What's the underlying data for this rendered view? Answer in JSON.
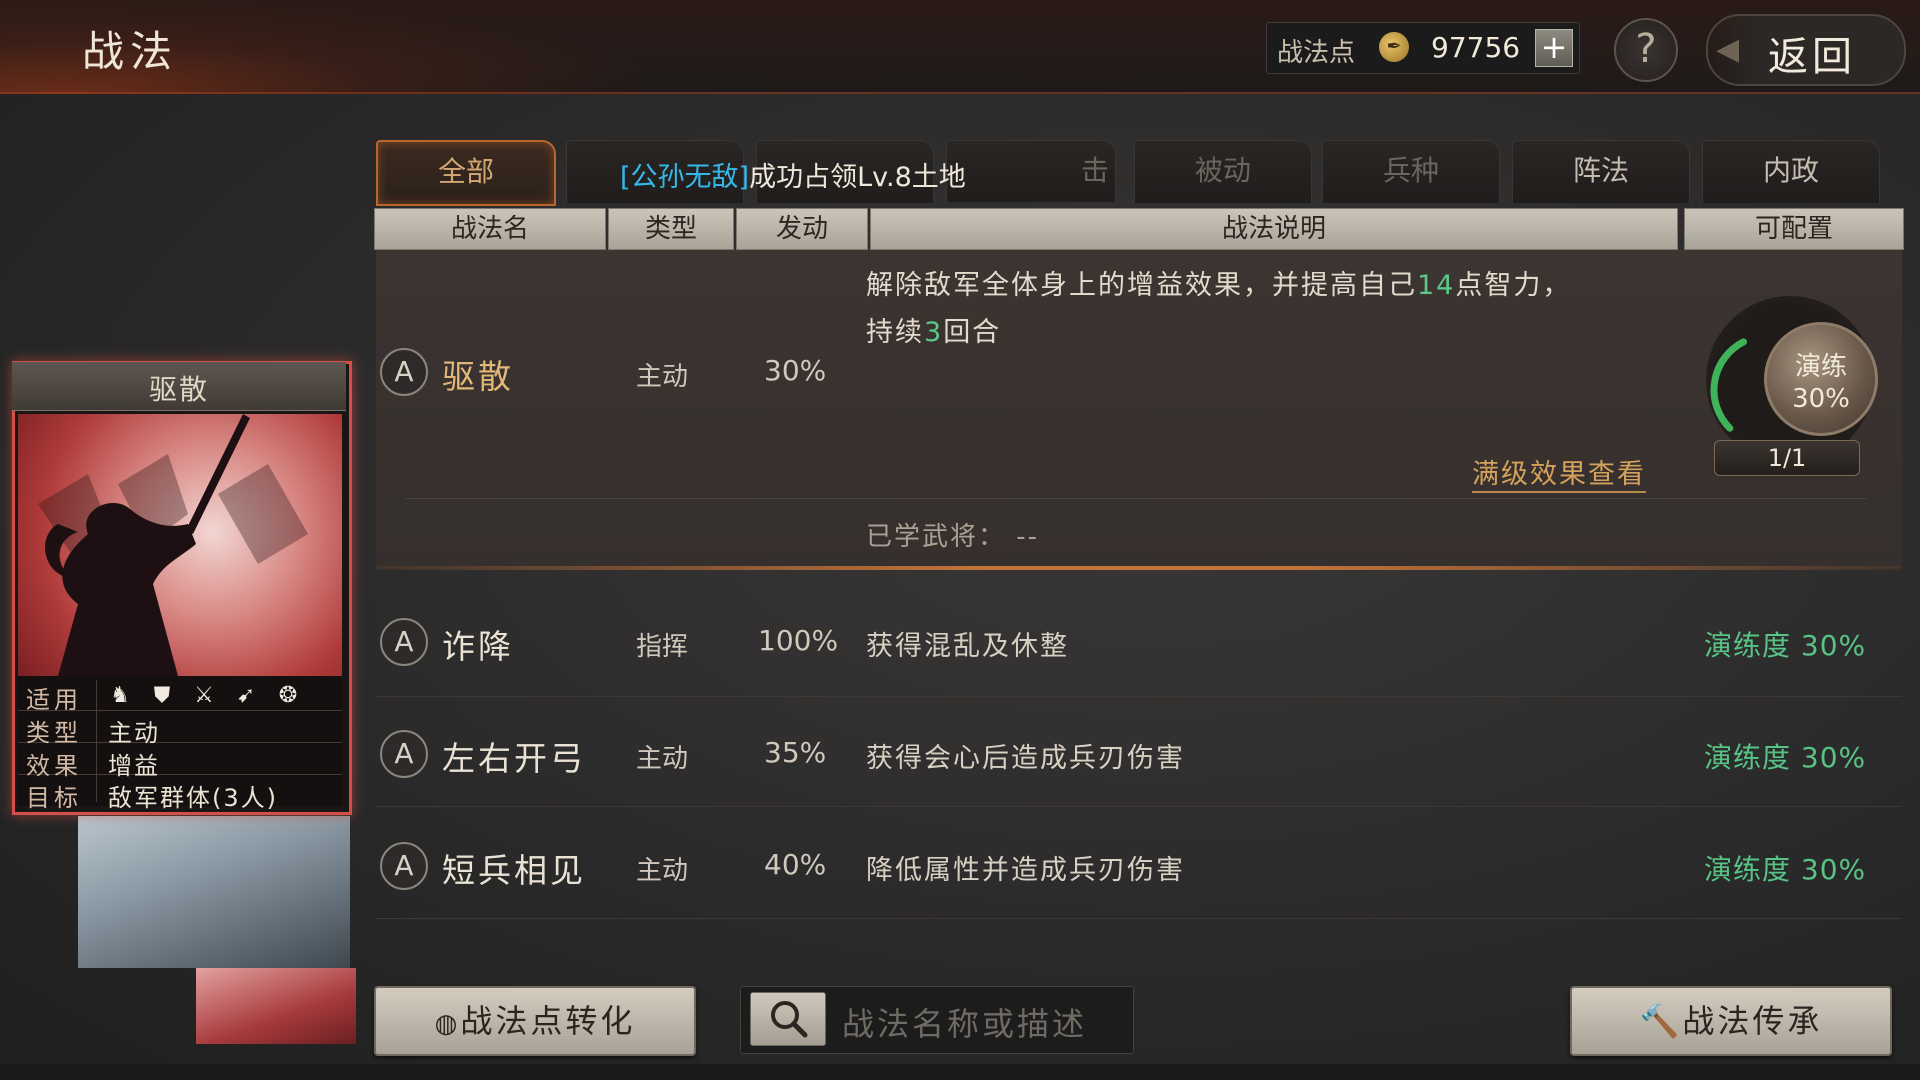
{
  "header": {
    "title": "战法",
    "points_label": "战法点",
    "points_value": "97756",
    "plus": "+",
    "help": "?",
    "back_label": "返回"
  },
  "tabs": [
    {
      "label": "全部",
      "active": true
    },
    {
      "label": "",
      "active": false
    },
    {
      "label": "",
      "active": false
    },
    {
      "label": "击",
      "active": false
    },
    {
      "label": "被动",
      "active": false
    },
    {
      "label": "兵种",
      "active": false
    },
    {
      "label": "阵法",
      "active": false
    },
    {
      "label": "内政",
      "active": false
    }
  ],
  "notice": {
    "highlight": "[公孙无敌]",
    "text": "成功占领Lv.8土地"
  },
  "columns": [
    "战法名",
    "类型",
    "发动",
    "战法说明",
    "可配置"
  ],
  "selected": {
    "grade": "A",
    "name": "驱散",
    "type": "主动",
    "rate": "30%",
    "desc_a": "解除敌军全体身上的增益效果，并提高自己",
    "desc_num1": "14",
    "desc_b": "点智力，",
    "desc_c": "持续",
    "desc_num2": "3",
    "desc_d": "回合",
    "full_effect_link": "满级效果查看",
    "learned_label": "已学武将：",
    "learned_value": "--",
    "practice_label": "演练",
    "practice_value": "30%",
    "practice_ratio": 0.3,
    "count": "1/1"
  },
  "rows": [
    {
      "grade": "A",
      "name": "诈降",
      "type": "指挥",
      "rate": "100%",
      "desc": "获得混乱及休整",
      "practice": "演练度 30%"
    },
    {
      "grade": "A",
      "name": "左右开弓",
      "type": "主动",
      "rate": "35%",
      "desc": "获得会心后造成兵刃伤害",
      "practice": "演练度 30%"
    },
    {
      "grade": "A",
      "name": "短兵相见",
      "type": "主动",
      "rate": "40%",
      "desc": "降低属性并造成兵刃伤害",
      "practice": "演练度 30%"
    }
  ],
  "card": {
    "title": "驱散",
    "apply_key": "适用",
    "type_key": "类型",
    "type_val": "主动",
    "effect_key": "效果",
    "effect_val": "增益",
    "target_key": "目标",
    "target_val": "敌军群体(3人)",
    "icons": [
      "cavalry-icon",
      "shield-icon",
      "crossed-swords-icon",
      "bow-icon",
      "wheel-icon"
    ]
  },
  "bottom": {
    "convert_button": "战法点转化",
    "search_placeholder": "战法名称或描述",
    "inherit_button": "战法传承"
  },
  "colors": {
    "accent": "#c4743a",
    "green": "#57c485",
    "highlight_blue": "#35b9ea",
    "card_border": "#d24f4a"
  }
}
